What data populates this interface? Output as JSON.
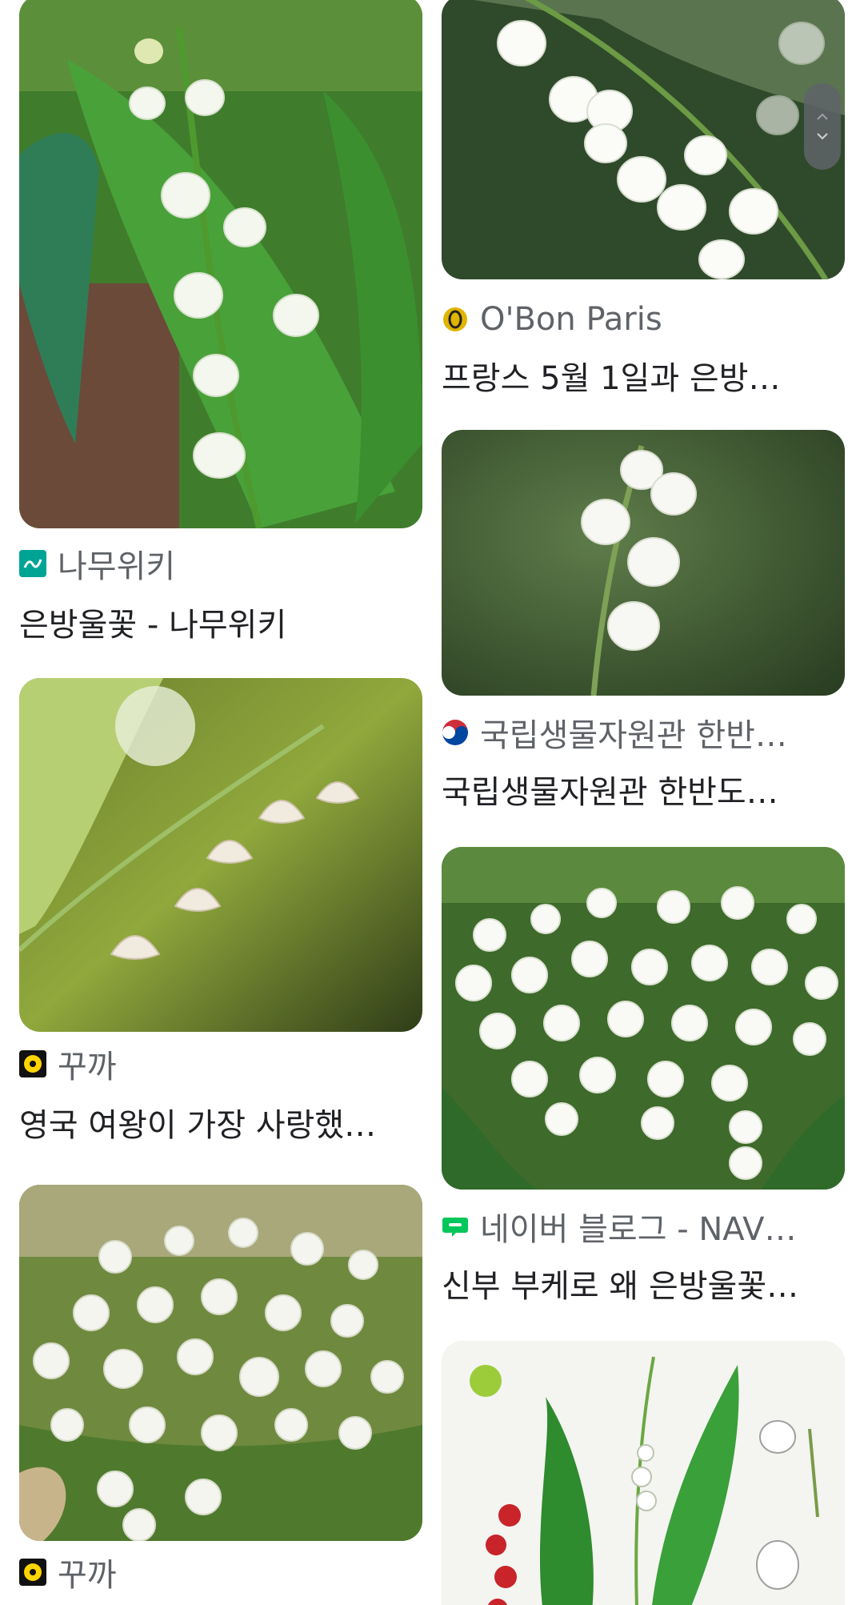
{
  "results": [
    {
      "source": "나무위키",
      "title": "은방울꽃 - 나무위키",
      "favicon": "namuwiki-icon",
      "favicon_color": "#00a495"
    },
    {
      "source": "O'Bon Paris",
      "title": "프랑스 5월 1일과 은방…",
      "favicon": "obon-paris-icon",
      "favicon_color": "#e0b400"
    },
    {
      "source": "국립생물자원관 한반…",
      "title": "국립생물자원관 한반도…",
      "favicon": "korea-flag-icon",
      "favicon_color": "#cd2e3a"
    },
    {
      "source": "꾸까",
      "title": "영국 여왕이 가장 사랑했…",
      "favicon": "kukka-icon",
      "favicon_color": "#ffd400"
    },
    {
      "source": "네이버 블로그 - NAV…",
      "title": "신부 부케로 왜 은방울꽃…",
      "favicon": "naver-blog-icon",
      "favicon_color": "#03c75a"
    },
    {
      "source": "꾸까",
      "title": "",
      "favicon": "kukka-icon",
      "favicon_color": "#ffd400"
    }
  ],
  "images": [
    "lily-of-the-valley-closeup-image",
    "lily-of-the-valley-white-bells-image",
    "lily-of-the-valley-single-stem-image",
    "lily-of-the-valley-arching-stem-image",
    "lily-of-the-valley-cluster-image",
    "lily-of-the-valley-bouquet-image",
    "lily-of-the-valley-botanical-illustration-image"
  ],
  "scroll_handle": {
    "icon_up": "chevron-up-icon",
    "icon_down": "chevron-down-icon"
  }
}
